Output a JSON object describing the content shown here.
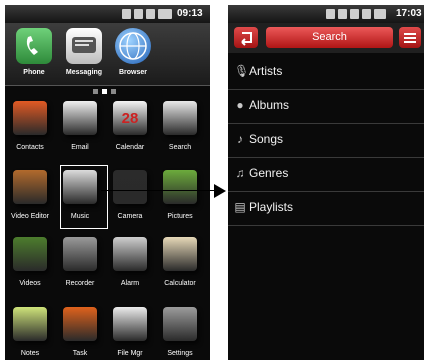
{
  "home": {
    "status_time": "09:13",
    "dock": [
      {
        "label": "Phone",
        "icon": "phone-icon",
        "color": "#3fa34d"
      },
      {
        "label": "Messaging",
        "icon": "messaging-icon",
        "color": "#e9e9e9"
      },
      {
        "label": "Browser",
        "icon": "browser-icon",
        "color": "#2a7fd6"
      }
    ],
    "apps": [
      {
        "label": "Contacts",
        "icon": "contacts-icon",
        "color": "#e25a24"
      },
      {
        "label": "Email",
        "icon": "email-icon",
        "color": "#f0f0f0"
      },
      {
        "label": "Calendar",
        "icon": "calendar-icon",
        "color": "#f4f4f4",
        "glyph": "28"
      },
      {
        "label": "Search",
        "icon": "search-icon",
        "color": "#e8e8e8"
      },
      {
        "label": "Video Editor",
        "icon": "video-editor-icon",
        "color": "#b26a2c"
      },
      {
        "label": "Music",
        "icon": "music-icon",
        "color": "#dcdcdc"
      },
      {
        "label": "Camera",
        "icon": "camera-icon",
        "color": "#2b2b2b"
      },
      {
        "label": "Pictures",
        "icon": "pictures-icon",
        "color": "#6cab3c"
      },
      {
        "label": "Videos",
        "icon": "videos-icon",
        "color": "#4d7d2d"
      },
      {
        "label": "Recorder",
        "icon": "recorder-icon",
        "color": "#9a9a9a"
      },
      {
        "label": "Alarm",
        "icon": "alarm-icon",
        "color": "#cfcfcf"
      },
      {
        "label": "Calculator",
        "icon": "calculator-icon",
        "color": "#e7d9b8"
      },
      {
        "label": "Notes",
        "icon": "notes-icon",
        "color": "#cfe47a"
      },
      {
        "label": "Task",
        "icon": "task-icon",
        "color": "#e0621c"
      },
      {
        "label": "File Mgr",
        "icon": "file-manager-icon",
        "color": "#ececec"
      },
      {
        "label": "Settings",
        "icon": "settings-icon",
        "color": "#9c9c9c"
      }
    ]
  },
  "music": {
    "status_time": "17:03",
    "search_label": "Search",
    "items": [
      {
        "label": "Artists",
        "icon": "microphone-icon",
        "glyph": "🎙"
      },
      {
        "label": "Albums",
        "icon": "disc-icon",
        "glyph": "●"
      },
      {
        "label": "Songs",
        "icon": "note-icon",
        "glyph": "♪"
      },
      {
        "label": "Genres",
        "icon": "notes-icon",
        "glyph": "♫"
      },
      {
        "label": "Playlists",
        "icon": "playlist-icon",
        "glyph": "▤"
      }
    ]
  }
}
